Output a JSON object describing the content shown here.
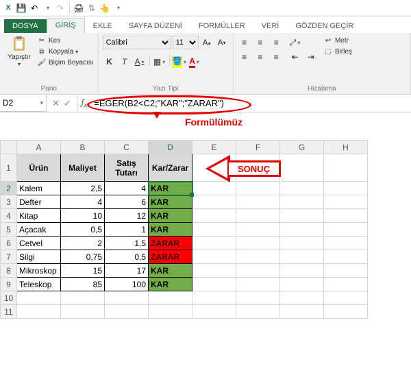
{
  "titlebar": {
    "app_icon": "XL"
  },
  "tabs": {
    "file": "DOSYA",
    "home": "GİRİŞ",
    "insert": "EKLE",
    "pagelayout": "SAYFA DÜZENİ",
    "formulas": "FORMÜLLER",
    "data": "VERİ",
    "review": "GÖZDEN GEÇİR"
  },
  "ribbon": {
    "clipboard": {
      "paste": "Yapıştır",
      "cut": "Kes",
      "copy": "Kopyala",
      "format_painter": "Biçim Boyacısı",
      "title": "Pano"
    },
    "font": {
      "name": "Calibri",
      "size": "11",
      "bold": "K",
      "italic": "T",
      "underline": "A",
      "title": "Yazı Tipi"
    },
    "align": {
      "wrap": "Metr",
      "merge": "Birleş",
      "title": "Hizalama"
    }
  },
  "name_box": "D2",
  "formula": "=EĞER(B2<C2;\"KAR\";\"ZARAR\")",
  "annot": {
    "formula_label": "Formülümüz",
    "result_label": "SONUÇ"
  },
  "columns": [
    "A",
    "B",
    "C",
    "D",
    "E",
    "F",
    "G",
    "H"
  ],
  "headers": {
    "a": "Ürün",
    "b": "Maliyet",
    "c": "Satış Tutarı",
    "d": "Kar/Zarar"
  },
  "rows": [
    {
      "n": 2,
      "a": "Kalem",
      "b": "2,5",
      "c": "4",
      "d": "KAR",
      "cls": "kar"
    },
    {
      "n": 3,
      "a": "Defter",
      "b": "4",
      "c": "6",
      "d": "KAR",
      "cls": "kar"
    },
    {
      "n": 4,
      "a": "Kitap",
      "b": "10",
      "c": "12",
      "d": "KAR",
      "cls": "kar"
    },
    {
      "n": 5,
      "a": "Açacak",
      "b": "0,5",
      "c": "1",
      "d": "KAR",
      "cls": "kar"
    },
    {
      "n": 6,
      "a": "Cetvel",
      "b": "2",
      "c": "1,5",
      "d": "ZARAR",
      "cls": "zarar"
    },
    {
      "n": 7,
      "a": "Silgi",
      "b": "0,75",
      "c": "0,5",
      "d": "ZARAR",
      "cls": "zarar"
    },
    {
      "n": 8,
      "a": "Mikroskop",
      "b": "15",
      "c": "17",
      "d": "KAR",
      "cls": "kar"
    },
    {
      "n": 9,
      "a": "Teleskop",
      "b": "85",
      "c": "100",
      "d": "KAR",
      "cls": "kar"
    }
  ]
}
